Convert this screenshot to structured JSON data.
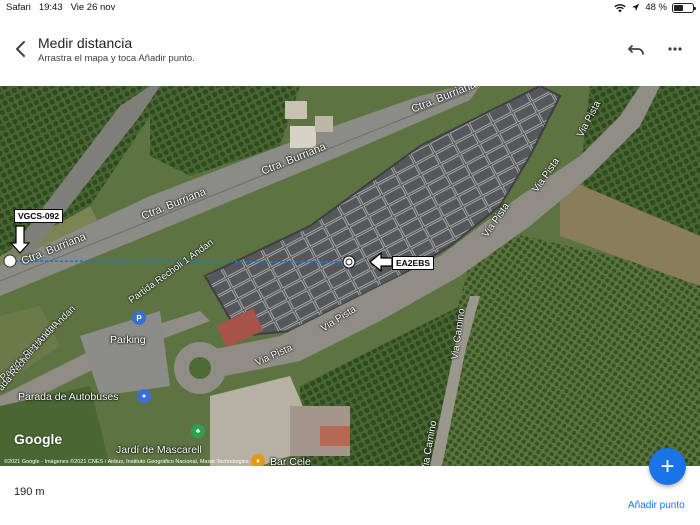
{
  "status_bar": {
    "app": "Safari",
    "time": "19:43",
    "date": "Vie 26 nov",
    "battery": "48 %",
    "battery_level": 0.48,
    "icons": [
      "wifi-icon",
      "location-arrow-icon",
      "battery-icon"
    ]
  },
  "header": {
    "title": "Medir distancia",
    "subtitle": "Arrastra el mapa y toca Añadir punto.",
    "icons": [
      "back-arrow-icon",
      "undo-icon",
      "more-vert-icon"
    ]
  },
  "map": {
    "road_labels": {
      "burriana_1": "Ctra. Burriana",
      "burriana_2": "Ctra. Burriana",
      "burriana_3": "Ctra. Burriana",
      "burriana_4": "Ctra. Burriana",
      "pista_1": "Via Pista",
      "pista_2": "Via Pista",
      "pista_3": "Via Pista",
      "pista_4": "Via Pista",
      "pista_5": "Via Pista",
      "camino_1": "Via Camino",
      "camino_2": "Via Camino",
      "recholi_1": "Partida Recholi 1 Andan",
      "recholi_2": "Partida Recholi 1 Andan",
      "recholi_3": "ada Recholi 1 Andan"
    },
    "poi": {
      "parking": "Parking",
      "bus_stop": "Parada de Autobuses",
      "park": "Jardí de Mascarell",
      "bar": "Bar Cele"
    },
    "tags": {
      "start": "VGCS-092",
      "end": "EA2EBS"
    },
    "google": "Google",
    "copyright": "©2021 Google - Imágenes ©2021 CNES / Airbus, Instituto Geográfico Nacional, Maxar Technologies",
    "accent_color": "#1a73e8"
  },
  "fab": {
    "icon": "plus-icon",
    "label": "+"
  },
  "bottom": {
    "distance": "190 m",
    "add_point": "Añadir punto"
  }
}
